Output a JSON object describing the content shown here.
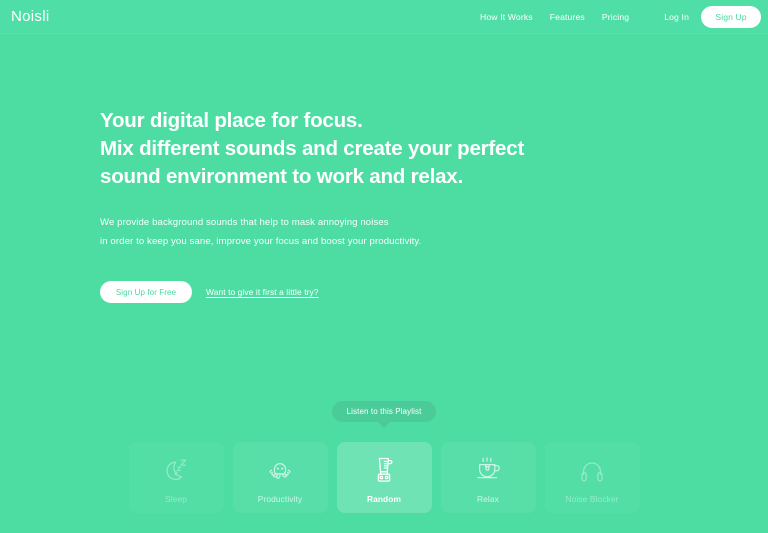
{
  "theme": {
    "background": "#4ddda3",
    "header_bg": "#4fdfa6",
    "accent_text": "#4bd79f",
    "tooltip_bg": "#4acb97",
    "text": "#ffffff"
  },
  "header": {
    "logo": "Noisli",
    "nav": [
      {
        "label": "How It Works",
        "name": "nav-how-it-works"
      },
      {
        "label": "Features",
        "name": "nav-features"
      },
      {
        "label": "Pricing",
        "name": "nav-pricing"
      }
    ],
    "login_label": "Log In",
    "signup_label": "Sign Up"
  },
  "hero": {
    "headline_lines": [
      "Your digital place for focus.",
      "Mix different sounds and create your perfect",
      "sound environment to work and relax."
    ],
    "subtext_lines": [
      "We provide background sounds that help to mask annoying noises",
      "in order to keep you sane, improve your focus and boost your productivity."
    ],
    "primary_cta": "Sign Up for Free",
    "secondary_cta": "Want to give it first a little try?"
  },
  "playlist": {
    "tooltip": "Listen to this Playlist",
    "cards": [
      {
        "label": "Sleep",
        "icon": "moon-zzz-icon",
        "active": false
      },
      {
        "label": "Productivity",
        "icon": "octopus-icon",
        "active": false
      },
      {
        "label": "Random",
        "icon": "blender-icon",
        "active": true
      },
      {
        "label": "Relax",
        "icon": "teacup-icon",
        "active": false
      },
      {
        "label": "Noise Blocker",
        "icon": "headphones-icon",
        "active": false
      }
    ]
  }
}
